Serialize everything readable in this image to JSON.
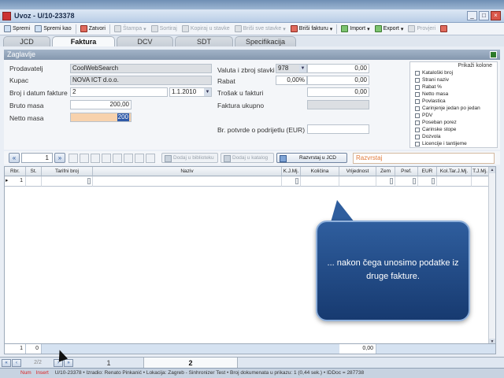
{
  "window": {
    "title": "Uvoz - U/10-23378"
  },
  "toolbar": {
    "items": [
      {
        "label": "Spremi",
        "icon": "save-icon"
      },
      {
        "label": "Spremi kao",
        "icon": "save-as-icon"
      },
      {
        "label": "Zatvori",
        "icon": "close-doc-icon"
      },
      {
        "label": "Štampa",
        "icon": "print-icon"
      },
      {
        "label": "Sortiraj",
        "icon": "sort-icon"
      },
      {
        "label": "Kopiraj u stavke",
        "icon": "copy-icon"
      },
      {
        "label": "Briši sve stavke",
        "icon": "delete-all-icon"
      },
      {
        "label": "Briši fakturu",
        "icon": "delete-invoice-icon"
      },
      {
        "label": "Import",
        "icon": "import-icon"
      },
      {
        "label": "Export",
        "icon": "export-icon"
      },
      {
        "label": "Provjeri",
        "icon": "check-icon"
      }
    ]
  },
  "tabs": [
    "JCD",
    "Faktura",
    "DCV",
    "SDT",
    "Specifikacija"
  ],
  "active_tab": "Faktura",
  "section": {
    "title": "Zaglavlje"
  },
  "form": {
    "prodavatelj_label": "Prodavatelj",
    "prodavatelj_value": "CoolWebSearch",
    "kupac_label": "Kupac",
    "kupac_value": "NOVA ICT d.o.o.",
    "broj_label": "Broj i datum fakture",
    "broj_value": "2",
    "datum_value": "1.1.2010",
    "bruto_label": "Bruto masa",
    "bruto_value": "200,00",
    "netto_label": "Netto masa",
    "netto_value": "200",
    "valuta_label": "Valuta i zbroj stavki",
    "valuta_value": "978",
    "zbroj_value": "0,00",
    "rabat_label": "Rabat",
    "rabat_pct": "0,00%",
    "rabat_value": "0,00",
    "trosak_label": "Trošak u fakturi",
    "trosak_value": "0,00",
    "ukupno_label": "Faktura ukupno",
    "ukupno_value": "",
    "potvrda_label": "Br. potvrde o podrijetlu (EUR)",
    "potvrda_value": ""
  },
  "columns_panel": {
    "title": "Prikaži kolone",
    "items": [
      "Kataloški broj",
      "Strani naziv",
      "Rabat %",
      "Netto masa",
      "Povlastica",
      "Carinjenje jedan po jedan",
      "PDV",
      "Poseban porez",
      "Carinske stope",
      "Dozvola",
      "Licencije i tantijeme"
    ]
  },
  "item_toolbar": {
    "page": "1",
    "dodaj_biblioteku": "Dodaj u biblioteku",
    "dodaj_katalog": "Dodaj u katalog",
    "razvrstaj_jcd": "Razvrstaj u JCD",
    "razvrstaj_field": "Razvrstaj"
  },
  "grid": {
    "headers": [
      "Rbr.",
      "St.",
      "Tarifni broj",
      "Naziv",
      "K.J.Mj.",
      "Količina",
      "Vrijednost",
      "Zem",
      "Pref.",
      "EUR",
      "Kol.Tar.J.Mj.",
      "T.J.Mj."
    ],
    "rows": [
      {
        "rbr": "1"
      }
    ],
    "footer": {
      "count": "1",
      "st": "0",
      "vrijednost": "0,00"
    }
  },
  "bottom": {
    "page_info": "2/2",
    "tabs": [
      "1",
      "2"
    ],
    "active_tab": "2"
  },
  "status": {
    "num": "Num",
    "ins": "Insert",
    "text": "U/10-23378 • Izradio: Renato Pinkanić • Lokacija: Zagreb - Sinhronizer Test • Broj dokumenata u prikazu: 1 (0,44 sek.) • IDDoc = 287738"
  },
  "callout": {
    "text": "... nakon čega unosimo podatke iz druge fakture."
  }
}
